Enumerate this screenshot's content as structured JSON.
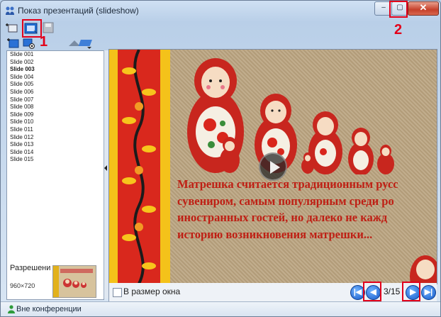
{
  "window": {
    "title": "Показ презентаций (slideshow)",
    "minimize_label": "‒",
    "maximize_label": "▢",
    "close_label": "✕"
  },
  "markers": {
    "one": "1",
    "two": "2"
  },
  "slides": [
    "Slide 001",
    "Slide 002",
    "Slide 003",
    "Slide 004",
    "Slide 005",
    "Slide 006",
    "Slide 007",
    "Slide 008",
    "Slide 009",
    "Slide 010",
    "Slide 011",
    "Slide 012",
    "Slide 013",
    "Slide 014",
    "Slide 015"
  ],
  "active_slide_index": 2,
  "left_panel": {
    "resolution_label": "Разрешени",
    "resolution_value": "960×720"
  },
  "slide_content": {
    "lines": [
      "Матрешка считается традиционным русс",
      "сувениром, самым популярным среди ро",
      "иностранных гостей, но далеко не кажд",
      "историю возникновения матрешки..."
    ]
  },
  "bottom_bar": {
    "fit_label": "В размер окна",
    "fit_checked": false,
    "page_counter": "3/15"
  },
  "status": {
    "conference_label": "Вне конференции"
  },
  "icons": [
    "app-icon",
    "add-icon",
    "open-icon",
    "save-icon",
    "new-slide-icon",
    "remove-slide-icon",
    "upload-icon",
    "first-icon",
    "prev-icon",
    "next-icon",
    "last-icon",
    "user-icon",
    "play-icon"
  ],
  "colors": {
    "accent_red": "#e2001a",
    "text_red": "#bf1f14",
    "nav_blue": "#1559c8"
  }
}
